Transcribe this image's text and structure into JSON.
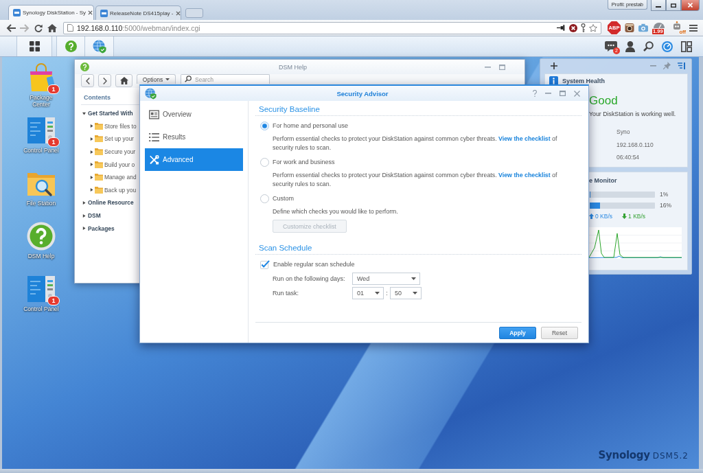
{
  "browser": {
    "tabs": [
      {
        "title": "Synology DiskStation - Sy",
        "selected": true
      },
      {
        "title": "ReleaseNote DS415play -",
        "selected": false
      }
    ],
    "profile": "Profil: prestab",
    "address": {
      "host": "192.168.0.110",
      "path": ":5000/webman/index.cgi"
    },
    "extensions": [
      {
        "kind": "adblock",
        "badge": "ABP"
      },
      {
        "kind": "photo"
      },
      {
        "kind": "camera"
      },
      {
        "kind": "meter",
        "badge": "1.99"
      },
      {
        "kind": "robot",
        "badge": "off"
      }
    ]
  },
  "dsm_taskbar": {
    "apps": [
      {
        "kind": "main-menu"
      },
      {
        "kind": "help"
      },
      {
        "kind": "security"
      }
    ],
    "notifications": "2"
  },
  "desktop_icons": [
    {
      "kind": "package",
      "label": "Package Center",
      "badge": "1"
    },
    {
      "kind": "control",
      "label": "Control Panel",
      "badge": "1"
    },
    {
      "kind": "files",
      "label": "File Station"
    },
    {
      "kind": "help",
      "label": "DSM Help"
    },
    {
      "kind": "control",
      "label": "Control Panel",
      "badge": "1"
    }
  ],
  "help_window": {
    "title": "DSM Help",
    "options_button": "Options",
    "search": {
      "placeholder": "Search"
    },
    "contents_heading": "Contents",
    "tree": [
      {
        "label": "Get Started With",
        "expanded": true,
        "children": [
          {
            "label": "Store files to",
            "expanded": false
          },
          {
            "label": "Set up your",
            "expanded": false
          },
          {
            "label": "Secure your",
            "expanded": false
          },
          {
            "label": "Build your o",
            "expanded": false
          },
          {
            "label": "Manage and",
            "expanded": false
          },
          {
            "label": "Back up you",
            "expanded": false
          }
        ]
      },
      {
        "label": "Online Resource",
        "expanded": false
      },
      {
        "label": "DSM",
        "expanded": false
      },
      {
        "label": "Packages",
        "expanded": false
      }
    ]
  },
  "security_advisor": {
    "title": "Security Advisor",
    "nav": [
      {
        "kind": "overview",
        "label": "Overview",
        "selected": false
      },
      {
        "kind": "results",
        "label": "Results",
        "selected": false
      },
      {
        "kind": "advanced",
        "label": "Advanced",
        "selected": true
      }
    ],
    "baseline": {
      "heading": "Security Baseline",
      "options": [
        {
          "label": "For home and personal use",
          "selected": true,
          "description": "Perform essential checks to protect your DiskStation against common cyber threats.",
          "link": "View the checklist",
          "description_end": "of security rules to scan."
        },
        {
          "label": "For work and business",
          "selected": false,
          "description": "Perform essential checks to protect your DiskStation against common cyber threats.",
          "link": "View the checklist",
          "description_end": "of security rules to scan."
        },
        {
          "label": "Custom",
          "selected": false,
          "description": "Define which checks you would like to perform.",
          "button": {
            "label": "Customize checklist",
            "disabled": true
          }
        }
      ]
    },
    "schedule": {
      "heading": "Scan Schedule",
      "enable": {
        "label": "Enable regular scan schedule",
        "checked": true
      },
      "days": {
        "label": "Run on the following days:",
        "value": "Wed"
      },
      "time": {
        "label": "Run task:",
        "hour": "01",
        "separator": ":",
        "minute": "50"
      }
    },
    "buttons": [
      {
        "kind": "primary",
        "label": "Apply"
      },
      {
        "kind": "secondary",
        "label": "Reset"
      }
    ]
  },
  "widgets": {
    "health": {
      "title": "System Health",
      "status": "Good",
      "message": "Your DiskStation is working well.",
      "values": [
        "Syno",
        "192.168.0.110",
        "06:40:54"
      ]
    },
    "monitor": {
      "title": "e Monitor",
      "meters": [
        {
          "level": 0.01,
          "reading": "1%"
        },
        {
          "level": 0.16,
          "reading": "16%"
        }
      ],
      "upload": "0 KB/s",
      "download": "1 KB/s"
    }
  },
  "wallpaper_logo": {
    "brand": "Synology",
    "version": "DSM5.2"
  }
}
